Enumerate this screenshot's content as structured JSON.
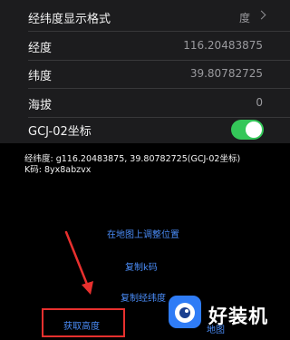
{
  "settings": {
    "rows": [
      {
        "label": "经纬度显示格式",
        "value": "度"
      },
      {
        "label": "经度",
        "value": "116.20483875"
      },
      {
        "label": "纬度",
        "value": "39.80782725"
      },
      {
        "label": "海拔",
        "value": "0"
      },
      {
        "label": "GCJ-02坐标",
        "toggle_on": true
      }
    ]
  },
  "info": {
    "line1": "经纬度: g116.20483875, 39.80782725(GCJ-02坐标)",
    "line2": "K码: 8yx8abzvx"
  },
  "actions": {
    "adjust": "在地图上调整位置",
    "copy_k": "复制k码",
    "copy_latlng": "复制经纬度",
    "get_altitude": "获取高度",
    "partial": "地图"
  },
  "watermark": {
    "text": "好装机"
  },
  "colors": {
    "accent": "#4a8cf7",
    "toggle": "#34c759",
    "annotation": "#e8302e"
  }
}
